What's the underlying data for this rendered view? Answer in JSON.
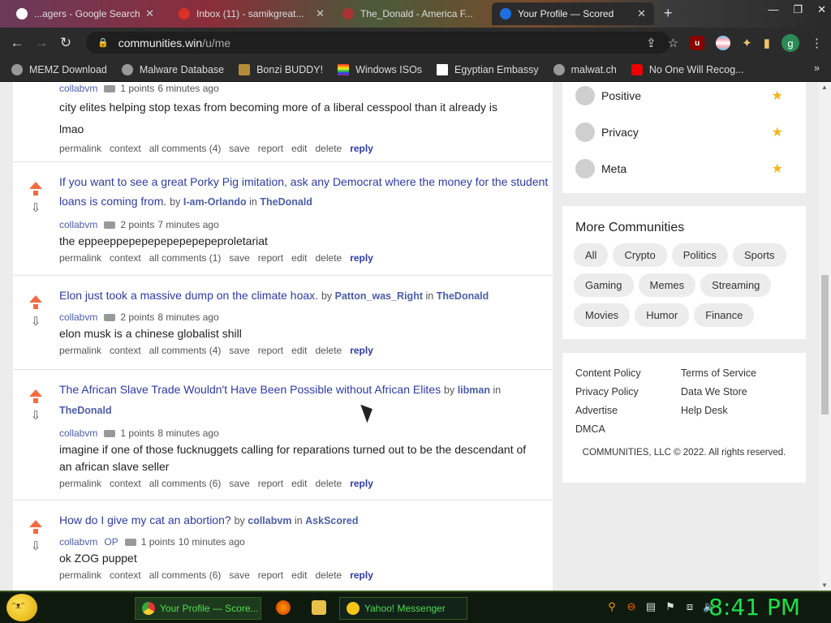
{
  "browser": {
    "tabs": [
      {
        "label": "...agers - Google Search",
        "color": "#4285f4"
      },
      {
        "label": "Inbox (11) - samikgreat...",
        "color": "#d93025"
      },
      {
        "label": "The_Donald - America F...",
        "color": "#a33"
      },
      {
        "label": "Your Profile — Scored",
        "color": "#1d6fe0"
      }
    ],
    "url_host": "communities.win",
    "url_path": "/u/me",
    "profile_initial": "g"
  },
  "bookmarks": [
    "MEMZ Download",
    "Malware Database",
    "Bonzi BUDDY!",
    "Windows ISOs",
    "Egyptian Embassy",
    "malwat.ch",
    "No One Will Recog..."
  ],
  "posts": [
    {
      "title": "",
      "by": "",
      "community": "",
      "user": "collabvm",
      "op": "",
      "points": "1 points",
      "time": "6 minutes ago",
      "body": "city elites helping stop texas from becoming more of a liberal cesspool than it already is",
      "body2": "lmao",
      "comments": "all comments (4)"
    },
    {
      "title": "If you want to see a great Porky Pig imitation, ask any Democrat where the money for the student loans is coming from.",
      "by": "I-am-Orlando",
      "community": "TheDonald",
      "user": "collabvm",
      "op": "",
      "points": "2 points",
      "time": "7 minutes ago",
      "body": "the eppeeppepepepepepepepeproletariat",
      "body2": "",
      "comments": "all comments (1)"
    },
    {
      "title": "Elon just took a massive dump on the climate hoax.",
      "by": "Patton_was_Right",
      "community": "TheDonald",
      "user": "collabvm",
      "op": "",
      "points": "2 points",
      "time": "8 minutes ago",
      "body": "elon musk is a chinese globalist shill",
      "body2": "",
      "comments": "all comments (4)"
    },
    {
      "title": "The African Slave Trade Wouldn't Have Been Possible without African Elites",
      "by": "libman",
      "community": "TheDonald",
      "user": "collabvm",
      "op": "",
      "points": "1 points",
      "time": "8 minutes ago",
      "body": "imagine if one of those fucknuggets calling for reparations turned out to be the descendant of an african slave seller",
      "body2": "",
      "comments": "all comments (6)"
    },
    {
      "title": "How do I give my cat an abortion?",
      "by": "collabvm",
      "community": "AskScored",
      "user": "collabvm",
      "op": "OP",
      "points": "1 points",
      "time": "10 minutes ago",
      "body": "ok ZOG puppet",
      "body2": "",
      "comments": "all comments (6)"
    }
  ],
  "labels": {
    "by": "by",
    "in": "in",
    "permalink": "permalink",
    "context": "context",
    "save": "save",
    "report": "report",
    "edit": "edit",
    "delete": "delete",
    "reply": "reply"
  },
  "sidebar": {
    "categories": [
      "Positive",
      "Privacy",
      "Meta"
    ],
    "more_title": "More Communities",
    "chips": [
      "All",
      "Crypto",
      "Politics",
      "Sports",
      "Gaming",
      "Memes",
      "Streaming",
      "Movies",
      "Humor",
      "Finance"
    ],
    "footer_links": [
      "Content Policy",
      "Terms of Service",
      "Privacy Policy",
      "Data We Store",
      "Advertise",
      "Help Desk",
      "DMCA"
    ],
    "copyright": "COMMUNITIES, LLC © 2022. All rights reserved."
  },
  "taskbar": {
    "buttons": [
      "Your Profile — Score...",
      "Yahoo! Messenger"
    ],
    "clock": "8:41 PM"
  },
  "colors": {
    "link": "#2e3ba6",
    "upvote": "#f36b43",
    "star": "#f2b51a",
    "clock": "#1ee04b"
  }
}
